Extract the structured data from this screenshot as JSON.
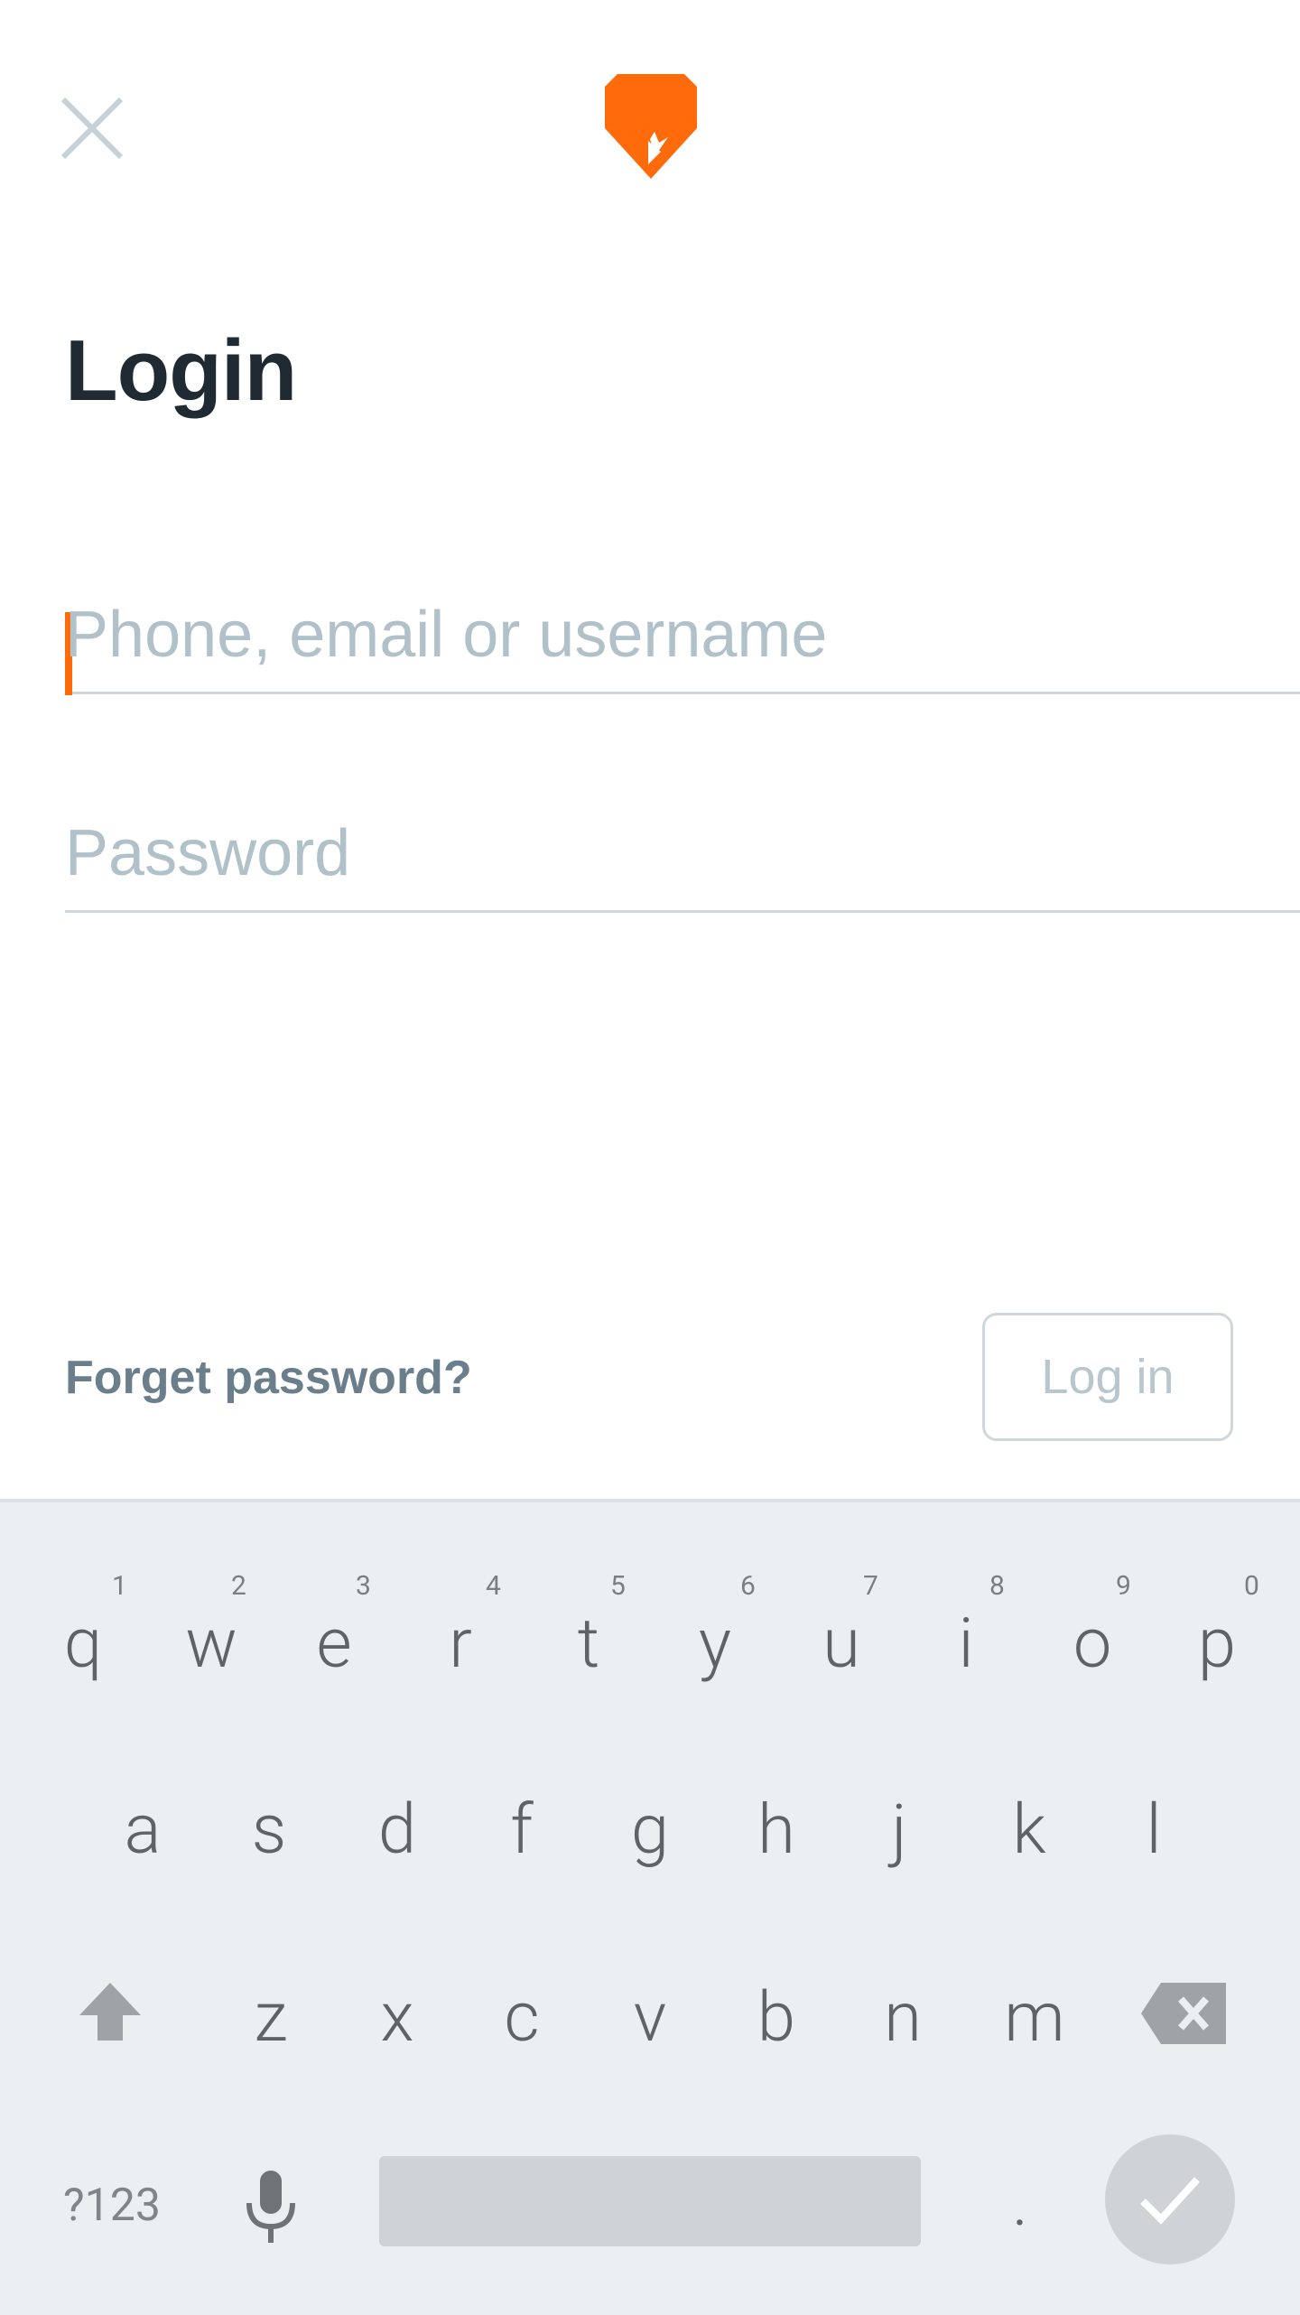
{
  "colors": {
    "accent": "#ff6b0a",
    "title": "#1f2a33",
    "muted": "#b1c1c9",
    "link": "#6a7f8b"
  },
  "header": {
    "logo_icon": "shield-logo-icon",
    "close_icon": "close-icon"
  },
  "login": {
    "title": "Login",
    "username_placeholder": "Phone, email or username",
    "password_placeholder": "Password",
    "forgot_label": "Forget password?",
    "login_button": "Log in"
  },
  "keyboard": {
    "row1": [
      {
        "letter": "q",
        "hint": "1"
      },
      {
        "letter": "w",
        "hint": "2"
      },
      {
        "letter": "e",
        "hint": "3"
      },
      {
        "letter": "r",
        "hint": "4"
      },
      {
        "letter": "t",
        "hint": "5"
      },
      {
        "letter": "y",
        "hint": "6"
      },
      {
        "letter": "u",
        "hint": "7"
      },
      {
        "letter": "i",
        "hint": "8"
      },
      {
        "letter": "o",
        "hint": "9"
      },
      {
        "letter": "p",
        "hint": "0"
      }
    ],
    "row2": [
      "a",
      "s",
      "d",
      "f",
      "g",
      "h",
      "j",
      "k",
      "l"
    ],
    "row3": [
      "z",
      "x",
      "c",
      "v",
      "b",
      "n",
      "m"
    ],
    "symbols_label": "?123",
    "period_label": ".",
    "icons": [
      "shift-icon",
      "backspace-icon",
      "microphone-icon",
      "checkmark-icon"
    ]
  }
}
